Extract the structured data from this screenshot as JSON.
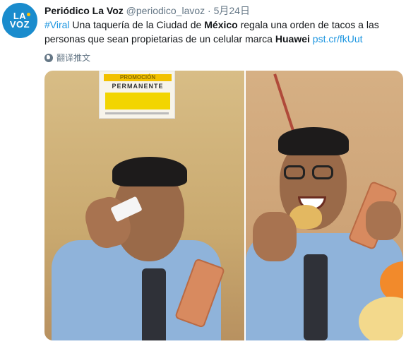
{
  "account": {
    "avatar_text_line1": "LA",
    "avatar_text_line2": "VOZ",
    "name": "Periódico La Voz",
    "handle": "@periodico_lavoz",
    "separator": "·",
    "date": "5月24日"
  },
  "tweet": {
    "hashtag": "#Viral",
    "text_part1": " Una taquería de la Ciudad de ",
    "bold1": "México",
    "text_part2": " regala una orden de tacos a las personas que sean propietarias de un celular marca ",
    "bold2": "Huawei",
    "link": "pst.cr/fkUut"
  },
  "translate": {
    "label": "翻译推文",
    "icon": "globe-icon"
  },
  "photos": {
    "sign_line1": "PROMOCIÓN",
    "sign_line2": "PERMANENTE"
  },
  "colors": {
    "link": "#1b95e0",
    "avatar_bg": "#1a8ccd",
    "secondary_text": "#657786"
  }
}
